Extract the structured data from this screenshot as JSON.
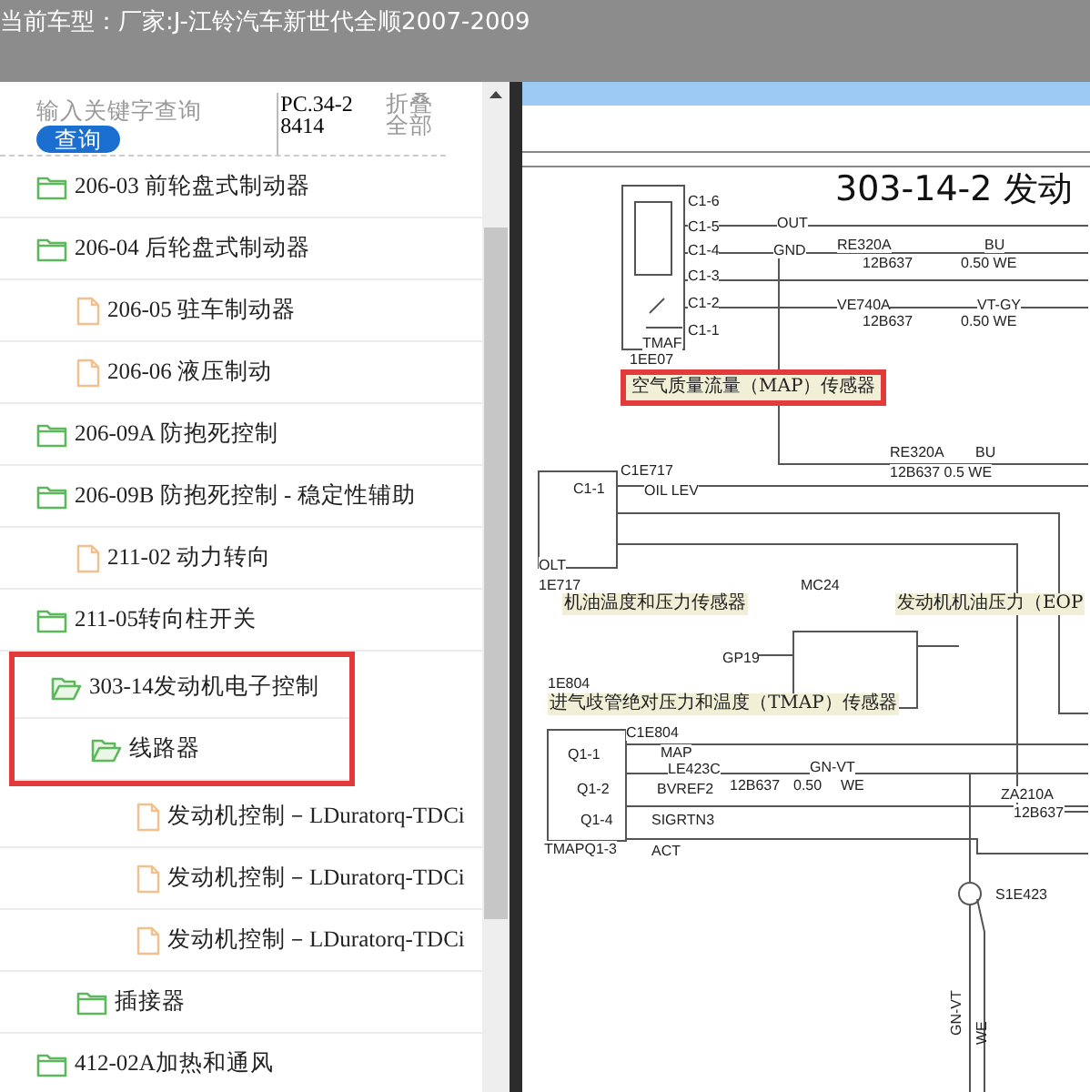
{
  "header": {
    "label": "当前车型：",
    "model": "厂家:J-江铃汽车新世代全顺2007-2009"
  },
  "search": {
    "placeholder": "输入关键字查询",
    "button": "查询"
  },
  "doc_code": "PC.34-28414",
  "collapse_all": "折叠全部",
  "tree": [
    {
      "label": "206-03 前轮盘式制动器",
      "kind": "folder",
      "expanded": false,
      "highlighted": false
    },
    {
      "label": "206-04 后轮盘式制动器",
      "kind": "folder",
      "expanded": false,
      "highlighted": false,
      "children": [
        {
          "label": "206-05 驻车制动器",
          "kind": "file",
          "highlighted": false
        },
        {
          "label": "206-06 液压制动",
          "kind": "file",
          "highlighted": false
        }
      ]
    },
    {
      "label": "206-09A 防抱死控制",
      "kind": "folder",
      "expanded": false,
      "highlighted": false
    },
    {
      "label": "206-09B 防抱死控制 - 稳定性辅助",
      "kind": "folder",
      "expanded": false,
      "highlighted": false,
      "children": [
        {
          "label": "211-02 动力转向",
          "kind": "file",
          "highlighted": false
        }
      ]
    },
    {
      "label": "211-05转向柱开关",
      "kind": "folder",
      "expanded": false,
      "highlighted": false
    },
    {
      "label": "303-14发动机电子控制",
      "kind": "folder",
      "expanded": true,
      "highlighted": true,
      "children": [
        {
          "label": "线路器",
          "kind": "folder",
          "expanded": true,
          "highlighted": true,
          "children": [
            {
              "label": "发动机控制－LDuratorq-TDCi",
              "kind": "file",
              "highlighted": false
            },
            {
              "label": "发动机控制－LDuratorq-TDCi",
              "kind": "file",
              "highlighted": false
            },
            {
              "label": "发动机控制－LDuratorq-TDCi",
              "kind": "file",
              "highlighted": false
            }
          ]
        },
        {
          "label": "插接器",
          "kind": "folder",
          "expanded": false,
          "highlighted": false
        }
      ]
    },
    {
      "label": "412-02A加热和通风",
      "kind": "folder",
      "expanded": false,
      "highlighted": false
    }
  ],
  "diagram": {
    "title": "303-14-2 发动",
    "labels": [
      {
        "text": "C1-6",
        "kind": "tag",
        "highlighted": false
      },
      {
        "text": "C1-5",
        "kind": "tag",
        "highlighted": false
      },
      {
        "text": "C1-4",
        "kind": "tag",
        "highlighted": false
      },
      {
        "text": "C1-3",
        "kind": "tag",
        "highlighted": false
      },
      {
        "text": "C1-2",
        "kind": "tag",
        "highlighted": false
      },
      {
        "text": "C1-1",
        "kind": "tag",
        "highlighted": false
      },
      {
        "text": "TMAF",
        "kind": "tag",
        "highlighted": false
      },
      {
        "text": "OUT",
        "kind": "tag",
        "highlighted": false
      },
      {
        "text": "GND",
        "kind": "tag",
        "highlighted": false
      },
      {
        "text": "RE320A",
        "kind": "tag",
        "highlighted": false
      },
      {
        "text": "12B637",
        "kind": "tag",
        "highlighted": false
      },
      {
        "text": "BU",
        "kind": "tag",
        "highlighted": false
      },
      {
        "text": "0.50 WE",
        "kind": "tag",
        "highlighted": false
      },
      {
        "text": "VE740A",
        "kind": "tag",
        "highlighted": false
      },
      {
        "text": "12B637",
        "kind": "tag",
        "highlighted": false
      },
      {
        "text": "VT-GY",
        "kind": "tag",
        "highlighted": false
      },
      {
        "text": "0.50 WE",
        "kind": "tag",
        "highlighted": false
      },
      {
        "text": "1EE07",
        "kind": "tag",
        "highlighted": false
      },
      {
        "text": "空气质量流量（MAP）传感器",
        "kind": "caption",
        "highlighted": true
      },
      {
        "text": "RE320A",
        "kind": "tag",
        "highlighted": false
      },
      {
        "text": "BU",
        "kind": "tag",
        "highlighted": false
      },
      {
        "text": "12B637 0.5 WE",
        "kind": "tag",
        "highlighted": false
      },
      {
        "text": "C1E717",
        "kind": "tag",
        "highlighted": false
      },
      {
        "text": "C1-1",
        "kind": "tag",
        "highlighted": false
      },
      {
        "text": "OIL LEV",
        "kind": "tag",
        "highlighted": false
      },
      {
        "text": "OLT",
        "kind": "tag",
        "highlighted": false
      },
      {
        "text": "1E717",
        "kind": "tag",
        "highlighted": false
      },
      {
        "text": "MC24",
        "kind": "tag",
        "highlighted": false
      },
      {
        "text": "机油温度和压力传感器",
        "kind": "caption",
        "highlighted": false
      },
      {
        "text": "发动机机油压力（EOP",
        "kind": "caption",
        "highlighted": false
      },
      {
        "text": "GP19",
        "kind": "tag",
        "highlighted": false
      },
      {
        "text": "1E804",
        "kind": "tag",
        "highlighted": false
      },
      {
        "text": "进气歧管绝对压力和温度（TMAP）传感器",
        "kind": "caption",
        "highlighted": false
      },
      {
        "text": "C1E804",
        "kind": "tag",
        "highlighted": false
      },
      {
        "text": "Q1-1",
        "kind": "tag",
        "highlighted": false
      },
      {
        "text": "MAP",
        "kind": "tag",
        "highlighted": false
      },
      {
        "text": "LE423C",
        "kind": "tag",
        "highlighted": false
      },
      {
        "text": "GN-VT",
        "kind": "tag",
        "highlighted": false
      },
      {
        "text": "Q1-2",
        "kind": "tag",
        "highlighted": false
      },
      {
        "text": "BVREF2",
        "kind": "tag",
        "highlighted": false
      },
      {
        "text": "12B637",
        "kind": "tag",
        "highlighted": false
      },
      {
        "text": "0.50",
        "kind": "tag",
        "highlighted": false
      },
      {
        "text": "WE",
        "kind": "tag",
        "highlighted": false
      },
      {
        "text": "ZA210A",
        "kind": "tag",
        "highlighted": false
      },
      {
        "text": "12B637",
        "kind": "tag",
        "highlighted": false
      },
      {
        "text": "Q1-4",
        "kind": "tag",
        "highlighted": false
      },
      {
        "text": "SIGRTN3",
        "kind": "tag",
        "highlighted": false
      },
      {
        "text": "TMAPQ1-3",
        "kind": "tag",
        "highlighted": false
      },
      {
        "text": "ACT",
        "kind": "tag",
        "highlighted": false
      },
      {
        "text": "S1E423",
        "kind": "tag",
        "highlighted": false
      },
      {
        "text": "GN-VT",
        "kind": "vertical",
        "highlighted": false
      },
      {
        "text": "WE",
        "kind": "vertical",
        "highlighted": false
      }
    ]
  }
}
